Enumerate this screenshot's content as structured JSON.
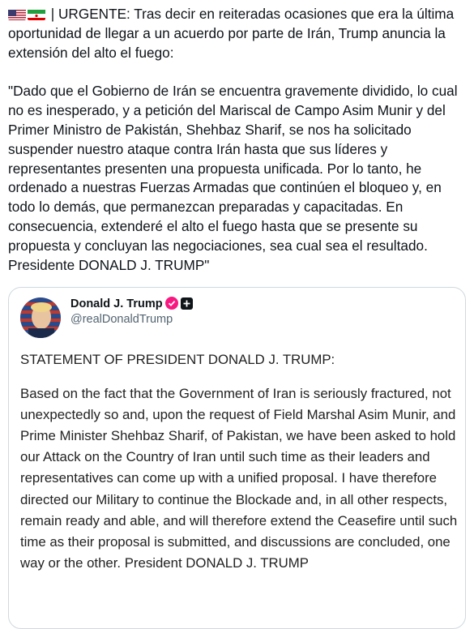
{
  "tweet": {
    "prefix": "| URGENTE: Tras decir en reiteradas ocasiones que era la última oportunidad de llegar a un acuerdo por parte de Irán, Trump anuncia la extensión del alto el fuego:",
    "quote": "\"Dado que el Gobierno de Irán se encuentra gravemente dividido, lo cual no es inesperado, y a petición del Mariscal de Campo Asim Munir y del Primer Ministro de Pakistán, Shehbaz Sharif, se nos ha solicitado suspender nuestro ataque contra Irán hasta que sus líderes y representantes presenten una propuesta unificada. Por lo tanto, he ordenado a nuestras Fuerzas Armadas que continúen el bloqueo y, en todo lo demás, que permanezcan preparadas y capacitadas. En consecuencia, extenderé el alto el fuego hasta que se presente su propuesta y concluyan las negociaciones, sea cual sea el resultado. Presidente DONALD J. TRUMP\"",
    "flags": [
      "us-flag-icon",
      "iran-flag-icon"
    ]
  },
  "card": {
    "name": "Donald J. Trump",
    "handle": "@realDonaldTrump",
    "title": "STATEMENT OF PRESIDENT DONALD J. TRUMP:",
    "body": "Based on the fact that the Government of Iran is seriously fractured, not unexpectedly so and, upon the request of Field Marshal Asim Munir, and Prime Minister Shehbaz Sharif, of Pakistan, we have been asked to hold our Attack on the Country of Iran until such time as their leaders and representatives can come up with a unified proposal. I have therefore directed our Military to continue the Blockade and, in all other respects, remain ready and able, and will therefore extend the Ceasefire until such time as their proposal is submitted, and discussions are concluded, one way or the other. President DONALD J. TRUMP"
  },
  "colors": {
    "text": "#0f1419",
    "secondary": "#536471",
    "border": "#cfd9de",
    "verified": "#f91880"
  }
}
